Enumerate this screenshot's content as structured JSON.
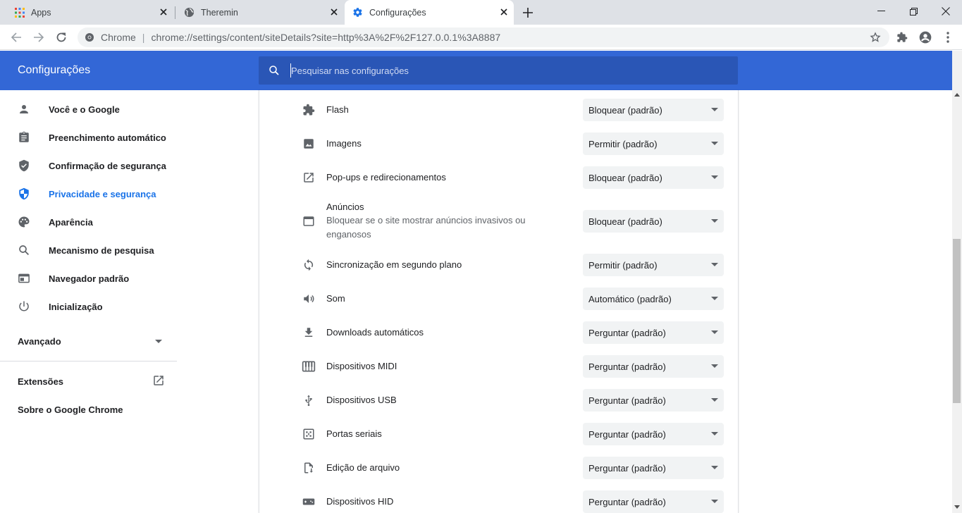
{
  "browser": {
    "tabs": [
      {
        "title": "Apps",
        "icon": "apps-grid-icon",
        "active": false
      },
      {
        "title": "Theremin",
        "icon": "globe-icon",
        "active": false
      },
      {
        "title": "Configurações",
        "icon": "settings-gear-icon",
        "active": true
      }
    ],
    "omnibox": {
      "site_label": "Chrome",
      "url": "chrome://settings/content/siteDetails?site=http%3A%2F%2F127.0.0.1%3A8887"
    }
  },
  "header": {
    "title": "Configurações",
    "search_placeholder": "Pesquisar nas configurações"
  },
  "sidebar": {
    "items": [
      {
        "label": "Você e o Google",
        "icon": "person-icon",
        "selected": false
      },
      {
        "label": "Preenchimento automático",
        "icon": "clipboard-icon",
        "selected": false
      },
      {
        "label": "Confirmação de segurança",
        "icon": "shield-check-icon",
        "selected": false
      },
      {
        "label": "Privacidade e segurança",
        "icon": "shield-icon",
        "selected": true
      },
      {
        "label": "Aparência",
        "icon": "palette-icon",
        "selected": false
      },
      {
        "label": "Mecanismo de pesquisa",
        "icon": "search-icon",
        "selected": false
      },
      {
        "label": "Navegador padrão",
        "icon": "browser-window-icon",
        "selected": false
      },
      {
        "label": "Inicialização",
        "icon": "power-icon",
        "selected": false
      }
    ],
    "advanced_label": "Avançado",
    "extensions_label": "Extensões",
    "about_label": "Sobre o Google Chrome"
  },
  "permissions": [
    {
      "label": "Flash",
      "icon": "puzzle-icon",
      "value": "Bloquear (padrão)"
    },
    {
      "label": "Imagens",
      "icon": "image-icon",
      "value": "Permitir (padrão)"
    },
    {
      "label": "Pop-ups e redirecionamentos",
      "icon": "open-external-icon",
      "value": "Bloquear (padrão)"
    },
    {
      "label": "Anúncios",
      "sub1": "Bloquear se o site mostrar anúncios invasivos ou",
      "sub2": "enganosos",
      "icon": "ad-window-icon",
      "value": "Bloquear (padrão)"
    },
    {
      "label": "Sincronização em segundo plano",
      "icon": "sync-icon",
      "value": "Permitir (padrão)"
    },
    {
      "label": "Som",
      "icon": "volume-icon",
      "value": "Automático (padrão)"
    },
    {
      "label": "Downloads automáticos",
      "icon": "download-icon",
      "value": "Perguntar (padrão)"
    },
    {
      "label": "Dispositivos MIDI",
      "icon": "piano-icon",
      "value": "Perguntar (padrão)"
    },
    {
      "label": "Dispositivos USB",
      "icon": "usb-icon",
      "value": "Perguntar (padrão)"
    },
    {
      "label": "Portas seriais",
      "icon": "serial-port-icon",
      "value": "Perguntar (padrão)"
    },
    {
      "label": "Edição de arquivo",
      "icon": "file-edit-icon",
      "value": "Perguntar (padrão)"
    },
    {
      "label": "Dispositivos HID",
      "icon": "gamepad-icon",
      "value": "Perguntar (padrão)"
    }
  ],
  "colors": {
    "header_blue": "#3367d6",
    "search_bg": "#2a56b6",
    "selected_blue": "#1a73e8"
  }
}
